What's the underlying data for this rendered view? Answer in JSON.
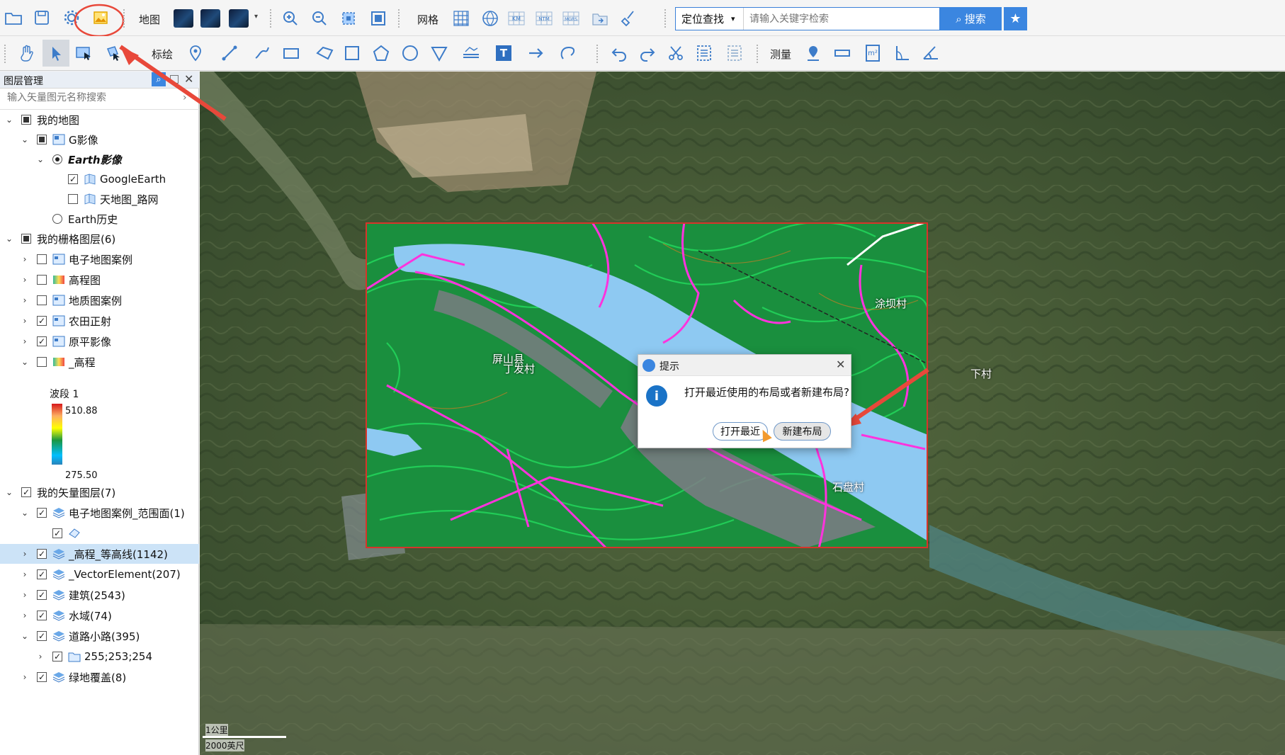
{
  "toolbar1": {
    "map_label": "地图",
    "grid_label": "网格",
    "grid_sub": [
      "KM",
      "NTM",
      "MGRS"
    ],
    "search_type": "定位查找",
    "search_placeholder": "请输入关键字检索",
    "search_button": "搜索"
  },
  "toolbar2": {
    "draw_label": "标绘",
    "measure_label": "测量",
    "text_tool_glyph": "T",
    "area_unit": "m²"
  },
  "layer_panel": {
    "title": "图层管理",
    "search_placeholder": "输入矢量图元名称搜索",
    "items": [
      {
        "label": "我的地图"
      },
      {
        "label": "G影像"
      },
      {
        "label": "Earth影像"
      },
      {
        "label": "GoogleEarth"
      },
      {
        "label": "天地图_路网"
      },
      {
        "label": "Earth历史"
      },
      {
        "label": "我的栅格图层(6)"
      },
      {
        "label": "电子地图案例"
      },
      {
        "label": "高程图"
      },
      {
        "label": "地质图案例"
      },
      {
        "label": "农田正射"
      },
      {
        "label": "原平影像"
      },
      {
        "label": "_高程"
      },
      {
        "label": "我的矢量图层(7)"
      },
      {
        "label": "电子地图案例_范围面(1)"
      },
      {
        "label": "_高程_等高线(1142)"
      },
      {
        "label": "_VectorElement(207)"
      },
      {
        "label": "建筑(2543)"
      },
      {
        "label": "水域(74)"
      },
      {
        "label": "道路小路(395)"
      },
      {
        "label": "255;253;254"
      },
      {
        "label": "绿地覆盖(8)"
      }
    ],
    "legend": {
      "band": "波段 1",
      "max": "510.88",
      "min": "275.50"
    }
  },
  "map": {
    "place_labels": [
      "涂坝村",
      "屏山县",
      "丁发村",
      "下村",
      "石盘村"
    ],
    "scale_km": "1公里",
    "scale_ft": "2000英尺"
  },
  "dialog": {
    "title": "提示",
    "message": "打开最近使用的布局或者新建布局?",
    "btn_recent": "打开最近",
    "btn_new": "新建布局"
  },
  "colors": {
    "accent": "#3b86e0",
    "annotation": "#e8483a",
    "contour_green": "#22d35a",
    "road_magenta": "#ff33dd",
    "river": "#8ec9f2"
  }
}
